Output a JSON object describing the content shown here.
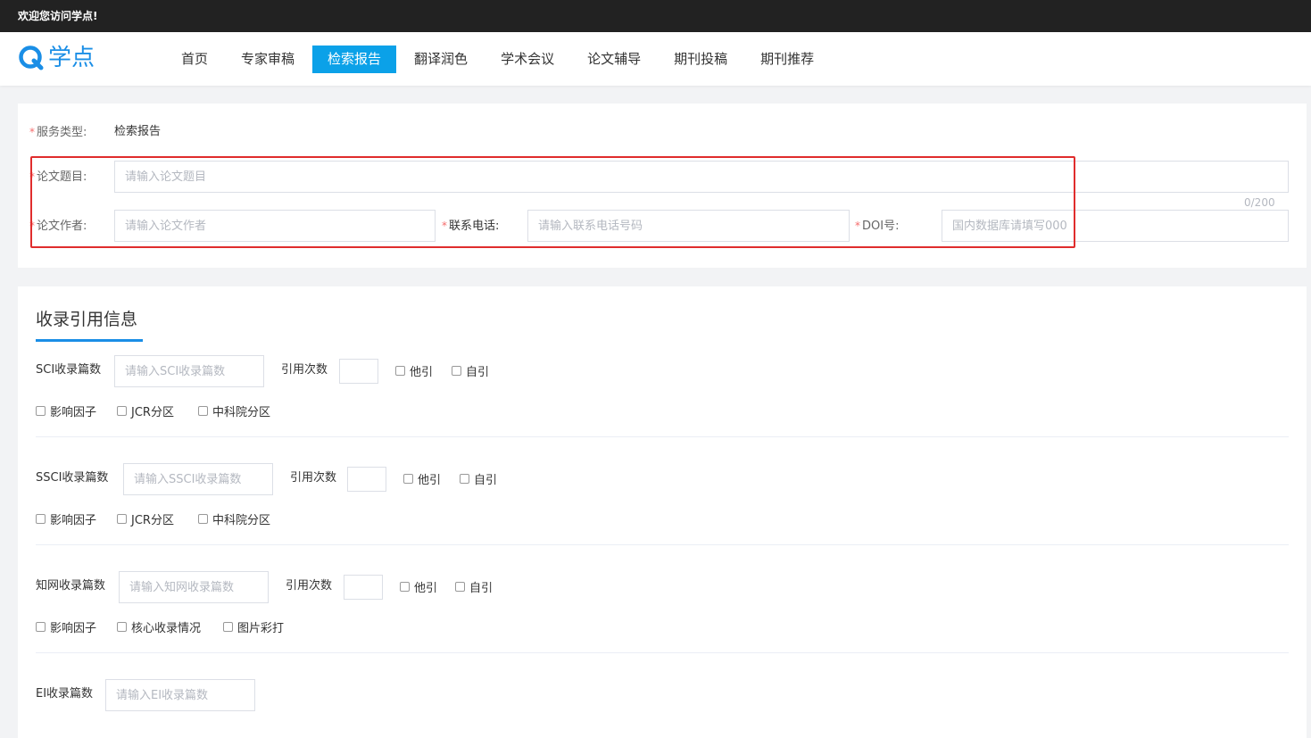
{
  "topbar": {
    "welcome": "欢迎您访问学点!"
  },
  "logo": {
    "text": "学点",
    "color": "#1a8ee6"
  },
  "nav": [
    {
      "label": "首页",
      "active": false
    },
    {
      "label": "专家审稿",
      "active": false
    },
    {
      "label": "检索报告",
      "active": true
    },
    {
      "label": "翻译润色",
      "active": false
    },
    {
      "label": "学术会议",
      "active": false
    },
    {
      "label": "论文辅导",
      "active": false
    },
    {
      "label": "期刊投稿",
      "active": false
    },
    {
      "label": "期刊推荐",
      "active": false
    }
  ],
  "form": {
    "service_type_label": "服务类型:",
    "service_type_value": "检索报告",
    "title_label": "论文题目:",
    "title_placeholder": "请输入论文题目",
    "title_counter": "0/200",
    "author_label": "论文作者:",
    "author_placeholder": "请输入论文作者",
    "phone_label": "联系电话:",
    "phone_placeholder": "请输入联系电话号码",
    "doi_label": "DOI号:",
    "doi_placeholder": "国内数据库请填写000",
    "required_mark": "*"
  },
  "citation": {
    "title": "收录引用信息",
    "sci": {
      "label": "SCI收录篇数",
      "placeholder": "请输入SCI收录篇数",
      "cite_label": "引用次数",
      "other": "他引",
      "self": "自引",
      "opts": [
        "影响因子",
        "JCR分区",
        "中科院分区"
      ]
    },
    "ssci": {
      "label": "SSCI收录篇数",
      "placeholder": "请输入SSCI收录篇数",
      "cite_label": "引用次数",
      "other": "他引",
      "self": "自引",
      "opts": [
        "影响因子",
        "JCR分区",
        "中科院分区"
      ]
    },
    "cnki": {
      "label": "知网收录篇数",
      "placeholder": "请输入知网收录篇数",
      "cite_label": "引用次数",
      "other": "他引",
      "self": "自引",
      "opts": [
        "影响因子",
        "核心收录情况",
        "图片彩打"
      ]
    },
    "ei": {
      "label": "EI收录篇数",
      "placeholder": "请输入EI收录篇数"
    }
  },
  "colors": {
    "accent": "#0ba1e8",
    "highlight_box": "#e02d2d"
  }
}
